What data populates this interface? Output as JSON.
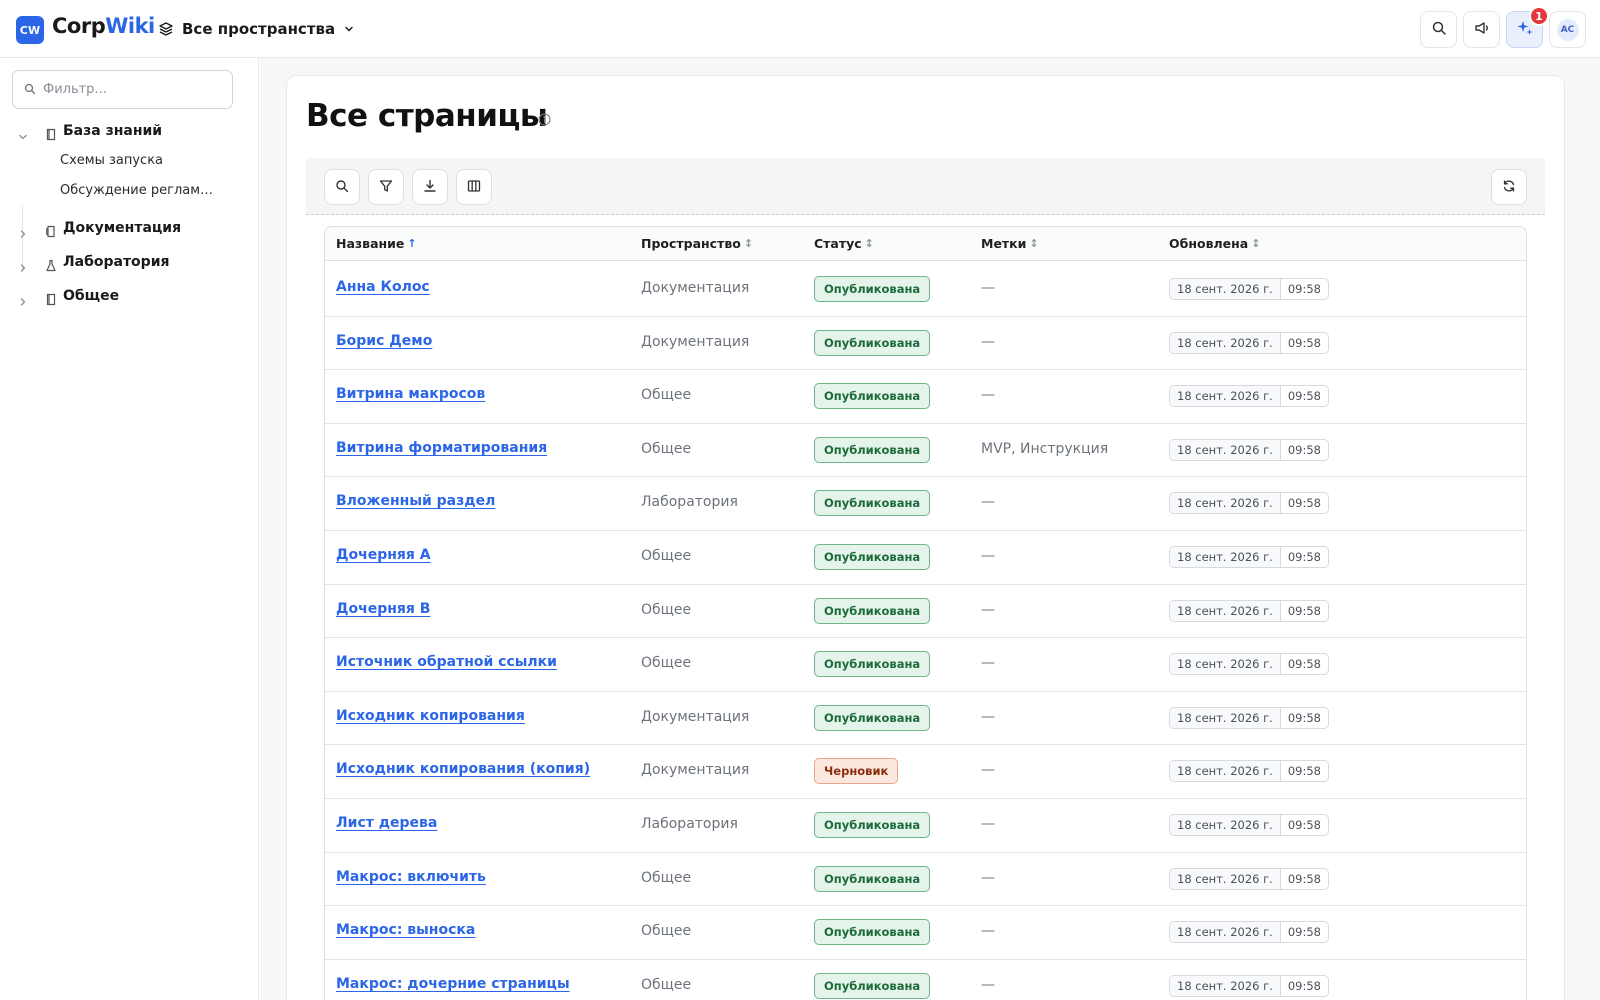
{
  "app": {
    "logo_badge": "CW",
    "logo_name_a": "Corp",
    "logo_name_b": "Wiki",
    "space_switch_label": "Все пространства",
    "notification_count": "1",
    "user_initials": "AC",
    "accent_color": "#2c66e8"
  },
  "sidebar": {
    "filter_placeholder": "Фильтр...",
    "tree": [
      {
        "label": "База знаний",
        "icon": "book-icon",
        "expanded": true,
        "children": [
          "Схемы запуска",
          "Обсуждение регламе..."
        ]
      },
      {
        "label": "Документация",
        "icon": "document-icon",
        "expanded": false
      },
      {
        "label": "Лаборатория",
        "icon": "flask-icon",
        "expanded": false
      },
      {
        "label": "Общее",
        "icon": "book-icon",
        "expanded": false
      }
    ]
  },
  "main": {
    "page_title": "Все страницы",
    "columns": {
      "title": "Название",
      "space": "Пространство",
      "status": "Статус",
      "tags": "Метки",
      "updated": "Обновлена"
    },
    "rows": [
      {
        "title": "Анна Колос",
        "space": "Документация",
        "status": "Опубликована",
        "status_kind": "published",
        "tags": "—",
        "date": "18 сент. 2026 г.",
        "time": "09:58"
      },
      {
        "title": "Борис Демо",
        "space": "Документация",
        "status": "Опубликована",
        "status_kind": "published",
        "tags": "—",
        "date": "18 сент. 2026 г.",
        "time": "09:58"
      },
      {
        "title": "Витрина макросов",
        "space": "Общее",
        "status": "Опубликована",
        "status_kind": "published",
        "tags": "—",
        "date": "18 сент. 2026 г.",
        "time": "09:58"
      },
      {
        "title": "Витрина форматирования",
        "space": "Общее",
        "status": "Опубликована",
        "status_kind": "published",
        "tags": "MVP, Инструкция",
        "date": "18 сент. 2026 г.",
        "time": "09:58"
      },
      {
        "title": "Вложенный раздел",
        "space": "Лаборатория",
        "status": "Опубликована",
        "status_kind": "published",
        "tags": "—",
        "date": "18 сент. 2026 г.",
        "time": "09:58"
      },
      {
        "title": "Дочерняя A",
        "space": "Общее",
        "status": "Опубликована",
        "status_kind": "published",
        "tags": "—",
        "date": "18 сент. 2026 г.",
        "time": "09:58"
      },
      {
        "title": "Дочерняя B",
        "space": "Общее",
        "status": "Опубликована",
        "status_kind": "published",
        "tags": "—",
        "date": "18 сент. 2026 г.",
        "time": "09:58"
      },
      {
        "title": "Источник обратной ссылки",
        "space": "Общее",
        "status": "Опубликована",
        "status_kind": "published",
        "tags": "—",
        "date": "18 сент. 2026 г.",
        "time": "09:58"
      },
      {
        "title": "Исходник копирования",
        "space": "Документация",
        "status": "Опубликована",
        "status_kind": "published",
        "tags": "—",
        "date": "18 сент. 2026 г.",
        "time": "09:58"
      },
      {
        "title": "Исходник копирования (копия)",
        "space": "Документация",
        "status": "Черновик",
        "status_kind": "draft",
        "tags": "—",
        "date": "18 сент. 2026 г.",
        "time": "09:58"
      },
      {
        "title": "Лист дерева",
        "space": "Лаборатория",
        "status": "Опубликована",
        "status_kind": "published",
        "tags": "—",
        "date": "18 сент. 2026 г.",
        "time": "09:58"
      },
      {
        "title": "Макрос: включить",
        "space": "Общее",
        "status": "Опубликована",
        "status_kind": "published",
        "tags": "—",
        "date": "18 сент. 2026 г.",
        "time": "09:58"
      },
      {
        "title": "Макрос: выноска",
        "space": "Общее",
        "status": "Опубликована",
        "status_kind": "published",
        "tags": "—",
        "date": "18 сент. 2026 г.",
        "time": "09:58"
      },
      {
        "title": "Макрос: дочерние страницы",
        "space": "Общее",
        "status": "Опубликована",
        "status_kind": "published",
        "tags": "—",
        "date": "18 сент. 2026 г.",
        "time": "09:58"
      }
    ]
  }
}
